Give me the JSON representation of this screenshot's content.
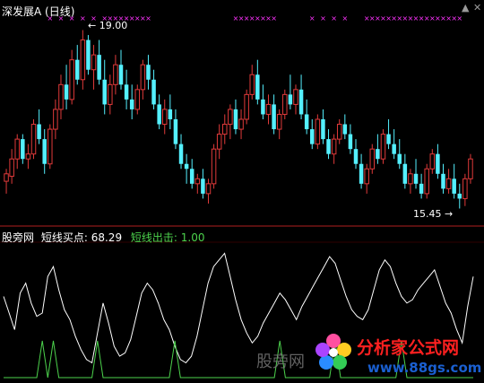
{
  "main_panel": {
    "title": "深发展A",
    "period": "(日线)",
    "high_label": "19.00",
    "low_label": "15.45",
    "high_arrow": "←",
    "low_arrow": "→",
    "controls": {
      "up": "▲",
      "close": "✕"
    },
    "colors": {
      "up": "#e03a3a",
      "down": "#54f0ff",
      "marker": "#ff33ff",
      "title": "#ffffff"
    }
  },
  "sub_panel": {
    "name": "股旁网",
    "indicator1_label": "短线买点:",
    "indicator1_value": "68.29",
    "indicator2_label": "短线出击:",
    "indicator2_value": "1.00",
    "colors": {
      "line1": "#ffffff",
      "line2": "#4cd24c",
      "separator": "#b02020"
    }
  },
  "watermark": {
    "brand_cn": "分析家公式网",
    "url": "www.88gs.com",
    "faint": "股旁网",
    "colors": {
      "brand": "#ff2020",
      "url": "#1a5fd0"
    }
  },
  "chart_data": {
    "type": "candlestick",
    "high_marker": 19.0,
    "low_marker": 15.45,
    "candles": [
      [
        15.95,
        16.2,
        15.7,
        16.1
      ],
      [
        16.05,
        16.6,
        15.9,
        16.4
      ],
      [
        16.4,
        16.9,
        16.2,
        16.8
      ],
      [
        16.8,
        16.9,
        16.3,
        16.4
      ],
      [
        16.4,
        16.7,
        16.2,
        16.5
      ],
      [
        16.5,
        17.2,
        16.4,
        17.1
      ],
      [
        17.1,
        17.4,
        16.7,
        16.8
      ],
      [
        16.8,
        17.0,
        16.1,
        16.3
      ],
      [
        16.3,
        17.1,
        16.2,
        17.0
      ],
      [
        17.0,
        17.6,
        16.8,
        17.4
      ],
      [
        17.4,
        18.1,
        17.2,
        17.9
      ],
      [
        17.9,
        18.3,
        17.4,
        17.6
      ],
      [
        17.6,
        18.6,
        17.5,
        18.4
      ],
      [
        18.4,
        18.7,
        17.9,
        18.0
      ],
      [
        18.0,
        19.0,
        17.8,
        18.8
      ],
      [
        18.8,
        18.9,
        18.1,
        18.2
      ],
      [
        18.2,
        18.7,
        17.8,
        18.5
      ],
      [
        18.5,
        18.8,
        17.9,
        18.0
      ],
      [
        18.0,
        18.4,
        17.3,
        17.5
      ],
      [
        17.5,
        18.1,
        17.3,
        17.9
      ],
      [
        17.9,
        18.5,
        17.7,
        18.3
      ],
      [
        18.3,
        18.6,
        17.8,
        17.9
      ],
      [
        17.9,
        18.2,
        17.4,
        17.6
      ],
      [
        17.6,
        17.9,
        17.2,
        17.4
      ],
      [
        17.4,
        17.9,
        17.3,
        17.8
      ],
      [
        17.8,
        18.4,
        17.6,
        18.3
      ],
      [
        18.3,
        18.5,
        17.8,
        18.0
      ],
      [
        18.0,
        18.2,
        17.4,
        17.5
      ],
      [
        17.5,
        17.7,
        17.0,
        17.1
      ],
      [
        17.1,
        17.6,
        16.9,
        17.4
      ],
      [
        17.4,
        17.7,
        17.0,
        17.2
      ],
      [
        17.2,
        17.4,
        16.6,
        16.7
      ],
      [
        16.7,
        16.9,
        16.2,
        16.3
      ],
      [
        16.3,
        16.5,
        15.9,
        16.2
      ],
      [
        16.2,
        16.4,
        15.8,
        15.9
      ],
      [
        15.9,
        16.1,
        15.7,
        16.0
      ],
      [
        16.0,
        16.2,
        15.6,
        15.7
      ],
      [
        15.7,
        16.0,
        15.5,
        15.9
      ],
      [
        15.9,
        16.7,
        15.8,
        16.6
      ],
      [
        16.6,
        17.1,
        16.4,
        16.9
      ],
      [
        16.9,
        17.3,
        16.7,
        17.1
      ],
      [
        17.1,
        17.5,
        16.8,
        17.4
      ],
      [
        17.4,
        17.6,
        16.9,
        17.0
      ],
      [
        17.0,
        17.4,
        16.8,
        17.2
      ],
      [
        17.2,
        17.8,
        17.1,
        17.7
      ],
      [
        17.7,
        18.3,
        17.6,
        18.1
      ],
      [
        18.1,
        18.4,
        17.5,
        17.6
      ],
      [
        17.6,
        17.9,
        17.2,
        17.3
      ],
      [
        17.3,
        17.7,
        17.1,
        17.5
      ],
      [
        17.5,
        17.7,
        16.9,
        17.0
      ],
      [
        17.0,
        17.4,
        16.8,
        17.3
      ],
      [
        17.3,
        17.8,
        17.2,
        17.7
      ],
      [
        17.7,
        18.1,
        17.4,
        17.5
      ],
      [
        17.5,
        17.9,
        17.3,
        17.8
      ],
      [
        17.8,
        18.1,
        17.2,
        17.3
      ],
      [
        17.3,
        17.6,
        16.9,
        17.0
      ],
      [
        17.0,
        17.2,
        16.6,
        16.7
      ],
      [
        16.7,
        17.3,
        16.6,
        17.2
      ],
      [
        17.2,
        17.4,
        16.7,
        16.8
      ],
      [
        16.8,
        17.0,
        16.4,
        16.5
      ],
      [
        16.5,
        16.9,
        16.3,
        16.8
      ],
      [
        16.8,
        17.2,
        16.7,
        17.1
      ],
      [
        17.1,
        17.3,
        16.8,
        16.9
      ],
      [
        16.9,
        17.1,
        16.5,
        16.6
      ],
      [
        16.6,
        16.8,
        16.2,
        16.3
      ],
      [
        16.3,
        16.5,
        15.8,
        15.9
      ],
      [
        15.9,
        16.3,
        15.7,
        16.2
      ],
      [
        16.2,
        16.7,
        16.1,
        16.6
      ],
      [
        16.6,
        16.9,
        16.3,
        16.4
      ],
      [
        16.4,
        17.0,
        16.3,
        16.9
      ],
      [
        16.9,
        17.2,
        16.6,
        16.7
      ],
      [
        16.7,
        17.0,
        16.4,
        16.5
      ],
      [
        16.5,
        16.8,
        16.2,
        16.3
      ],
      [
        16.3,
        16.5,
        15.8,
        15.9
      ],
      [
        15.9,
        16.2,
        15.7,
        16.1
      ],
      [
        16.1,
        16.4,
        15.8,
        15.9
      ],
      [
        15.9,
        16.1,
        15.6,
        15.7
      ],
      [
        15.7,
        16.3,
        15.6,
        16.2
      ],
      [
        16.2,
        16.6,
        16.1,
        16.5
      ],
      [
        16.5,
        16.7,
        16.0,
        16.1
      ],
      [
        16.1,
        16.3,
        15.7,
        15.8
      ],
      [
        15.8,
        16.2,
        15.7,
        16.0
      ],
      [
        16.0,
        16.3,
        15.6,
        15.7
      ],
      [
        15.7,
        15.9,
        15.4,
        15.6
      ],
      [
        15.6,
        16.1,
        15.45,
        16.0
      ],
      [
        16.0,
        16.5,
        15.9,
        16.4
      ]
    ],
    "indicator_buy": [
      50,
      40,
      30,
      52,
      58,
      46,
      38,
      40,
      62,
      68,
      54,
      42,
      36,
      26,
      18,
      12,
      10,
      28,
      46,
      34,
      20,
      14,
      16,
      24,
      38,
      52,
      58,
      54,
      46,
      36,
      30,
      20,
      12,
      10,
      14,
      26,
      42,
      58,
      68,
      72,
      76,
      62,
      48,
      36,
      28,
      22,
      26,
      34,
      40,
      46,
      52,
      48,
      42,
      36,
      44,
      50,
      56,
      62,
      68,
      74,
      70,
      60,
      50,
      42,
      38,
      36,
      42,
      54,
      66,
      72,
      68,
      58,
      50,
      46,
      48,
      54,
      58,
      62,
      66,
      56,
      46,
      40,
      30,
      22,
      44,
      62
    ],
    "indicator_attack": [
      0,
      0,
      0,
      0,
      0,
      0,
      0,
      1,
      0,
      1,
      0,
      0,
      0,
      0,
      0,
      0,
      0,
      1,
      0,
      0,
      0,
      0,
      0,
      0,
      0,
      0,
      0,
      0,
      0,
      0,
      0,
      1,
      0,
      0,
      0,
      0,
      0,
      0,
      0,
      0,
      0,
      0,
      0,
      0,
      0,
      0,
      0,
      0,
      0,
      0,
      1,
      0,
      0,
      0,
      0,
      0,
      0,
      0,
      0,
      0,
      1,
      0,
      0,
      0,
      0,
      0,
      0,
      0,
      0,
      0,
      0,
      0,
      1,
      0,
      0,
      0,
      0,
      0,
      0,
      0,
      0,
      0,
      0,
      0,
      0,
      0
    ]
  }
}
